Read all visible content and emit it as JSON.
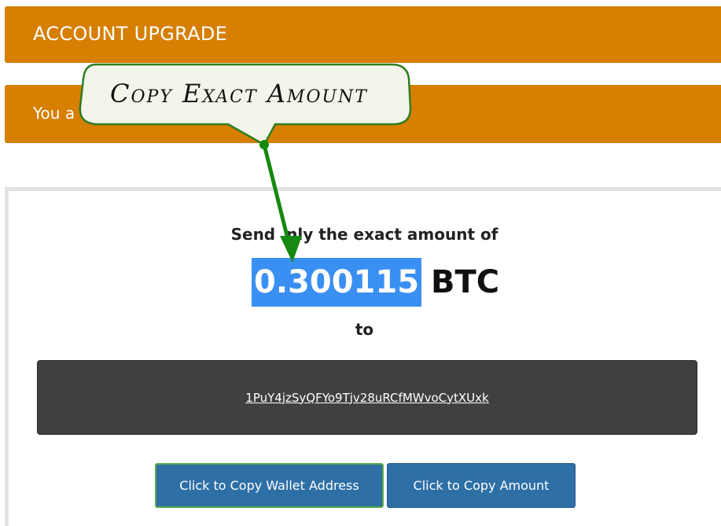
{
  "header": {
    "title": "ACCOUNT UPGRADE"
  },
  "notice": {
    "text_visible": "You a"
  },
  "payment": {
    "instruction_prefix": "Send",
    "instruction_suffix": "nly the exact amount of",
    "amount": "0.300115",
    "currency": "BTC",
    "to_label": "to",
    "wallet_address": "1PuY4jzSyQFYo9Tjv28uRCfMWvoCytXUxk"
  },
  "buttons": {
    "copy_wallet": "Click to Copy Wallet Address",
    "copy_amount": "Click to Copy Amount"
  },
  "annotation": {
    "callout_text": "Copy Exact Amount"
  },
  "colors": {
    "bar": "#d67f00",
    "highlight": "#3a8ff2",
    "wallet_box": "#404040",
    "button": "#2e6fa6",
    "callout_border": "#2f7d22",
    "arrow": "#168a10"
  }
}
